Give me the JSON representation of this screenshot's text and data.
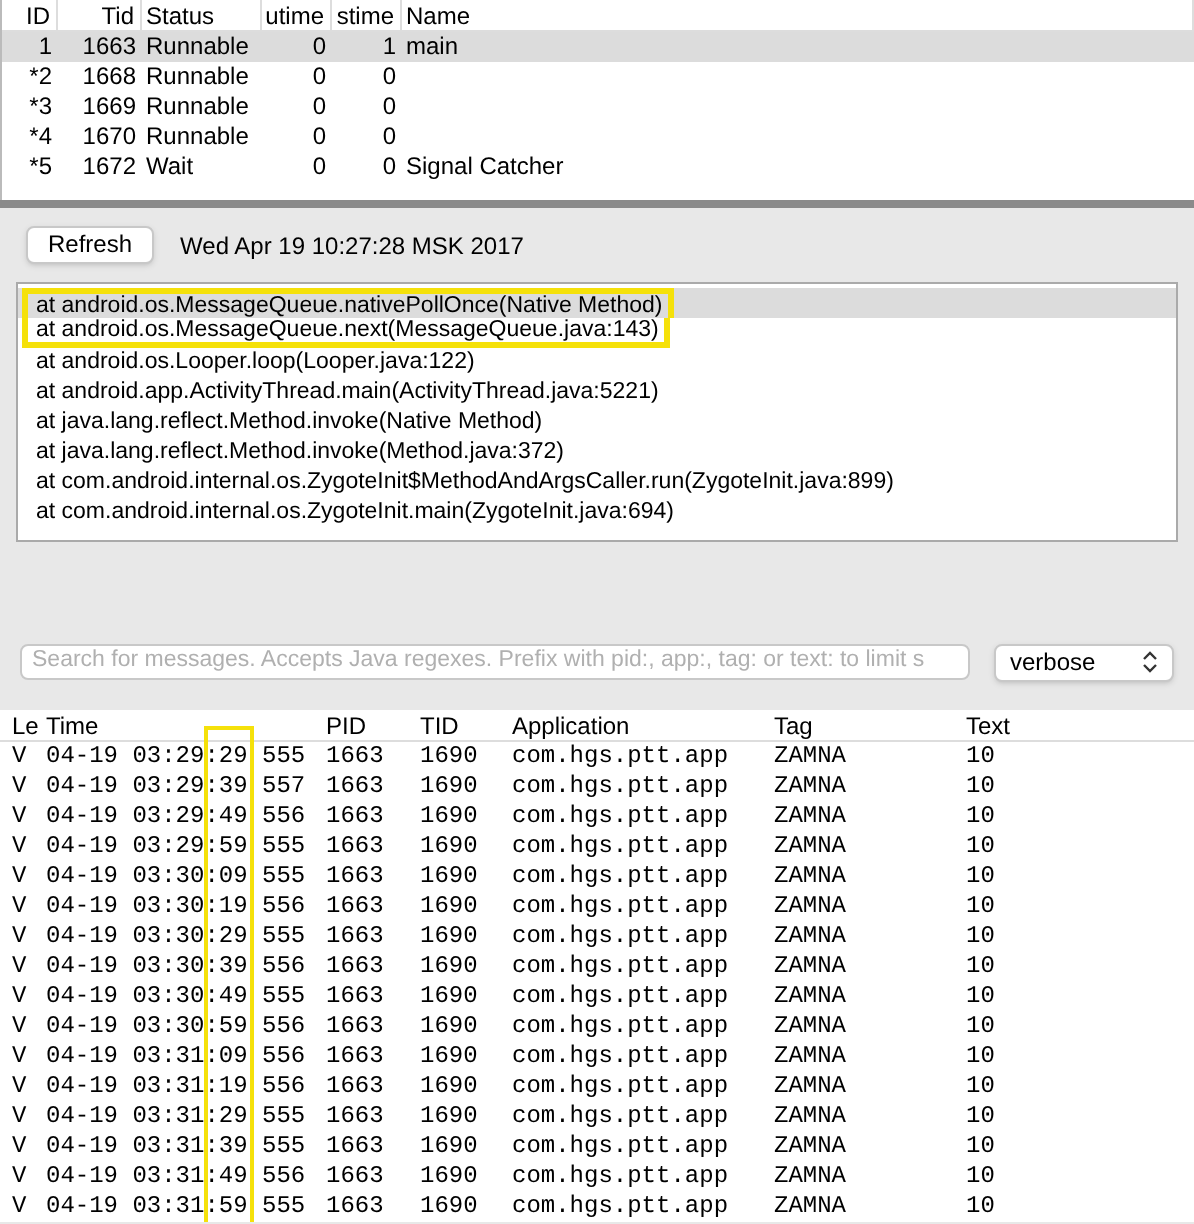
{
  "threads": {
    "columns": [
      "ID",
      "Tid",
      "Status",
      "utime",
      "stime",
      "Name"
    ],
    "rows": [
      {
        "id": "1",
        "tid": "1663",
        "status": "Runnable",
        "utime": "0",
        "stime": "1",
        "name": "main",
        "selected": true
      },
      {
        "id": "*2",
        "tid": "1668",
        "status": "Runnable",
        "utime": "0",
        "stime": "0",
        "selected": false
      },
      {
        "id": "*3",
        "tid": "1669",
        "status": "Runnable",
        "utime": "0",
        "stime": "0",
        "selected": false
      },
      {
        "id": "*4",
        "tid": "1670",
        "status": "Runnable",
        "utime": "0",
        "stime": "0",
        "selected": false
      },
      {
        "id": "*5",
        "tid": "1672",
        "status": "Wait",
        "utime": "0",
        "stime": "0",
        "name": "Signal Catcher",
        "selected": false
      }
    ]
  },
  "refresh_button": "Refresh",
  "timestamp": "Wed Apr 19 10:27:28 MSK 2017",
  "stack_trace": [
    {
      "text": "at android.os.MessageQueue.nativePollOnce(Native Method)",
      "selected": true,
      "highlighted": true
    },
    {
      "text": "at android.os.MessageQueue.next(MessageQueue.java:143)",
      "selected": false,
      "highlighted": true
    },
    {
      "text": "at android.os.Looper.loop(Looper.java:122)",
      "selected": false,
      "highlighted": false
    },
    {
      "text": "at android.app.ActivityThread.main(ActivityThread.java:5221)",
      "selected": false,
      "highlighted": false
    },
    {
      "text": "at java.lang.reflect.Method.invoke(Native Method)",
      "selected": false,
      "highlighted": false
    },
    {
      "text": "at java.lang.reflect.Method.invoke(Method.java:372)",
      "selected": false,
      "highlighted": false
    },
    {
      "text": "at com.android.internal.os.ZygoteInit$MethodAndArgsCaller.run(ZygoteInit.java:899)",
      "selected": false,
      "highlighted": false
    },
    {
      "text": "at com.android.internal.os.ZygoteInit.main(ZygoteInit.java:694)",
      "selected": false,
      "highlighted": false
    }
  ],
  "search": {
    "placeholder": "Search for messages. Accepts Java regexes. Prefix with pid:, app:, tag: or text: to limit s"
  },
  "level_select": {
    "value": "verbose"
  },
  "log": {
    "columns": [
      "Le",
      "Time",
      "PID",
      "TID",
      "Application",
      "Tag",
      "Text"
    ],
    "seconds_highlighted": true,
    "rows": [
      [
        "V",
        "04-19 03:29:29 555",
        "1663",
        "1690",
        "com.hgs.ptt.app",
        "ZAMNA",
        "10"
      ],
      [
        "V",
        "04-19 03:29:39 557",
        "1663",
        "1690",
        "com.hgs.ptt.app",
        "ZAMNA",
        "10"
      ],
      [
        "V",
        "04-19 03:29:49 556",
        "1663",
        "1690",
        "com.hgs.ptt.app",
        "ZAMNA",
        "10"
      ],
      [
        "V",
        "04-19 03:29:59 555",
        "1663",
        "1690",
        "com.hgs.ptt.app",
        "ZAMNA",
        "10"
      ],
      [
        "V",
        "04-19 03:30:09 555",
        "1663",
        "1690",
        "com.hgs.ptt.app",
        "ZAMNA",
        "10"
      ],
      [
        "V",
        "04-19 03:30:19 556",
        "1663",
        "1690",
        "com.hgs.ptt.app",
        "ZAMNA",
        "10"
      ],
      [
        "V",
        "04-19 03:30:29 555",
        "1663",
        "1690",
        "com.hgs.ptt.app",
        "ZAMNA",
        "10"
      ],
      [
        "V",
        "04-19 03:30:39 556",
        "1663",
        "1690",
        "com.hgs.ptt.app",
        "ZAMNA",
        "10"
      ],
      [
        "V",
        "04-19 03:30:49 555",
        "1663",
        "1690",
        "com.hgs.ptt.app",
        "ZAMNA",
        "10"
      ],
      [
        "V",
        "04-19 03:30:59 556",
        "1663",
        "1690",
        "com.hgs.ptt.app",
        "ZAMNA",
        "10"
      ],
      [
        "V",
        "04-19 03:31:09 556",
        "1663",
        "1690",
        "com.hgs.ptt.app",
        "ZAMNA",
        "10"
      ],
      [
        "V",
        "04-19 03:31:19 556",
        "1663",
        "1690",
        "com.hgs.ptt.app",
        "ZAMNA",
        "10"
      ],
      [
        "V",
        "04-19 03:31:29 555",
        "1663",
        "1690",
        "com.hgs.ptt.app",
        "ZAMNA",
        "10"
      ],
      [
        "V",
        "04-19 03:31:39 555",
        "1663",
        "1690",
        "com.hgs.ptt.app",
        "ZAMNA",
        "10"
      ],
      [
        "V",
        "04-19 03:31:49 556",
        "1663",
        "1690",
        "com.hgs.ptt.app",
        "ZAMNA",
        "10"
      ],
      [
        "V",
        "04-19 03:31:59 555",
        "1663",
        "1690",
        "com.hgs.ptt.app",
        "ZAMNA",
        "10"
      ]
    ]
  }
}
